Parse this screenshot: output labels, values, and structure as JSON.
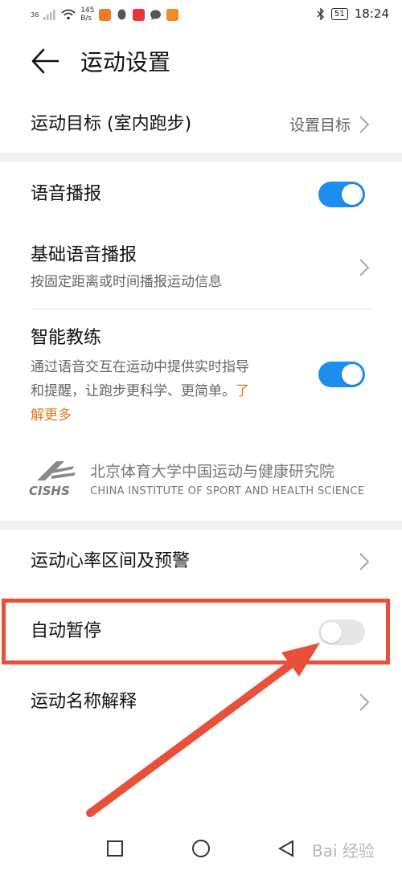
{
  "status_bar": {
    "signal": "36",
    "net_speed_value": "145",
    "net_speed_unit": "B/s",
    "battery": "51",
    "time": "18:24",
    "app_icons": [
      "taobao-icon",
      "qq-icon",
      "red-app-icon",
      "message-icon",
      "orange-app-icon"
    ]
  },
  "header": {
    "title": "运动设置"
  },
  "goal": {
    "label": "运动目标 (室内跑步)",
    "value": "设置目标"
  },
  "voice": {
    "label": "语音播报",
    "enabled": true
  },
  "basic_voice": {
    "label": "基础语音播报",
    "description": "按固定距离或时间播报运动信息"
  },
  "smart_coach": {
    "label": "智能教练",
    "description_line1": "通过语音交互在运动中提供实时指导",
    "description_line2": "和提醒，让跑步更科学、更简单。",
    "link_part1": "了",
    "link_part2": "解更多",
    "enabled": true
  },
  "partner": {
    "logo_text": "CISHS",
    "name_cn": "北京体育大学中国运动与健康研究院",
    "name_en": "CHINA INSTITUTE OF SPORT AND HEALTH SCIENCE"
  },
  "heart_rate": {
    "label": "运动心率区间及预警"
  },
  "auto_pause": {
    "label": "自动暂停",
    "enabled": false
  },
  "sport_names": {
    "label": "运动名称解释"
  },
  "watermark": "Bai 经验",
  "colors": {
    "accent": "#1c8ef0",
    "link": "#e07a22",
    "highlight": "#e8503a"
  }
}
